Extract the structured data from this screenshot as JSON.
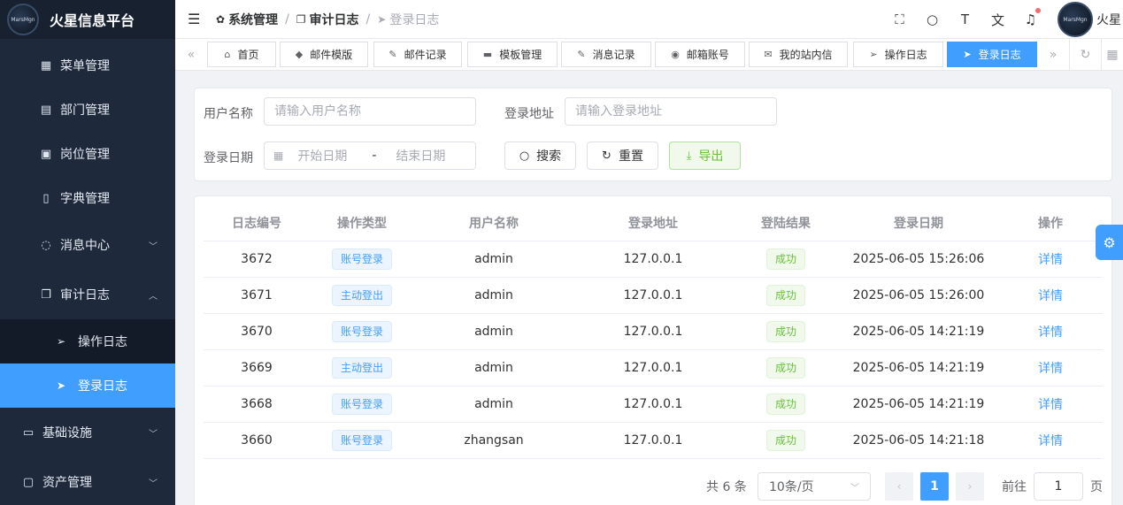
{
  "app": {
    "title": "火星信息平台",
    "logo_text": "MarsMgn"
  },
  "sidebar": {
    "items": [
      {
        "label": "菜单管理",
        "icon": "grid-icon"
      },
      {
        "label": "部门管理",
        "icon": "id-card-icon"
      },
      {
        "label": "岗位管理",
        "icon": "user-badge-icon"
      },
      {
        "label": "字典管理",
        "icon": "book-icon"
      },
      {
        "label": "消息中心",
        "icon": "chat-icon"
      },
      {
        "label": "审计日志",
        "icon": "copy-icon"
      }
    ],
    "subitems": [
      {
        "label": "操作日志",
        "icon": "send-icon"
      },
      {
        "label": "登录日志",
        "icon": "send-filled-icon"
      }
    ],
    "bottom_items": [
      {
        "label": "基础设施",
        "icon": "monitor-icon"
      },
      {
        "label": "资产管理",
        "icon": "screen-icon"
      }
    ]
  },
  "header": {
    "breadcrumb": [
      "系统管理",
      "审计日志",
      "登录日志"
    ],
    "username": "火星",
    "avatar_text": "MarsMgn"
  },
  "tabs": [
    "首页",
    "邮件模版",
    "邮件记录",
    "模板管理",
    "消息记录",
    "邮箱账号",
    "我的站内信",
    "操作日志",
    "登录日志"
  ],
  "search": {
    "username_label": "用户名称",
    "username_placeholder": "请输入用户名称",
    "address_label": "登录地址",
    "address_placeholder": "请输入登录地址",
    "date_label": "登录日期",
    "start_placeholder": "开始日期",
    "range_sep": "-",
    "end_placeholder": "结束日期",
    "search_btn": "搜索",
    "reset_btn": "重置",
    "export_btn": "导出"
  },
  "table": {
    "columns": [
      "日志编号",
      "操作类型",
      "用户名称",
      "登录地址",
      "登陆结果",
      "登录日期",
      "操作"
    ],
    "rows": [
      {
        "id": "3672",
        "type": "账号登录",
        "user": "admin",
        "ip": "127.0.0.1",
        "result": "成功",
        "date": "2025-06-05 15:26:06",
        "action": "详情"
      },
      {
        "id": "3671",
        "type": "主动登出",
        "user": "admin",
        "ip": "127.0.0.1",
        "result": "成功",
        "date": "2025-06-05 15:26:00",
        "action": "详情"
      },
      {
        "id": "3670",
        "type": "账号登录",
        "user": "admin",
        "ip": "127.0.0.1",
        "result": "成功",
        "date": "2025-06-05 14:21:19",
        "action": "详情"
      },
      {
        "id": "3669",
        "type": "主动登出",
        "user": "admin",
        "ip": "127.0.0.1",
        "result": "成功",
        "date": "2025-06-05 14:21:19",
        "action": "详情"
      },
      {
        "id": "3668",
        "type": "账号登录",
        "user": "admin",
        "ip": "127.0.0.1",
        "result": "成功",
        "date": "2025-06-05 14:21:19",
        "action": "详情"
      },
      {
        "id": "3660",
        "type": "账号登录",
        "user": "zhangsan",
        "ip": "127.0.0.1",
        "result": "成功",
        "date": "2025-06-05 14:21:18",
        "action": "详情"
      }
    ]
  },
  "pagination": {
    "total": "共 6 条",
    "page_size": "10条/页",
    "current": "1",
    "goto_label": "前往",
    "goto_value": "1",
    "page_suffix": "页"
  },
  "colors": {
    "primary": "#409eff",
    "success": "#67c23a",
    "sidebar_bg": "#1e2a3b"
  }
}
